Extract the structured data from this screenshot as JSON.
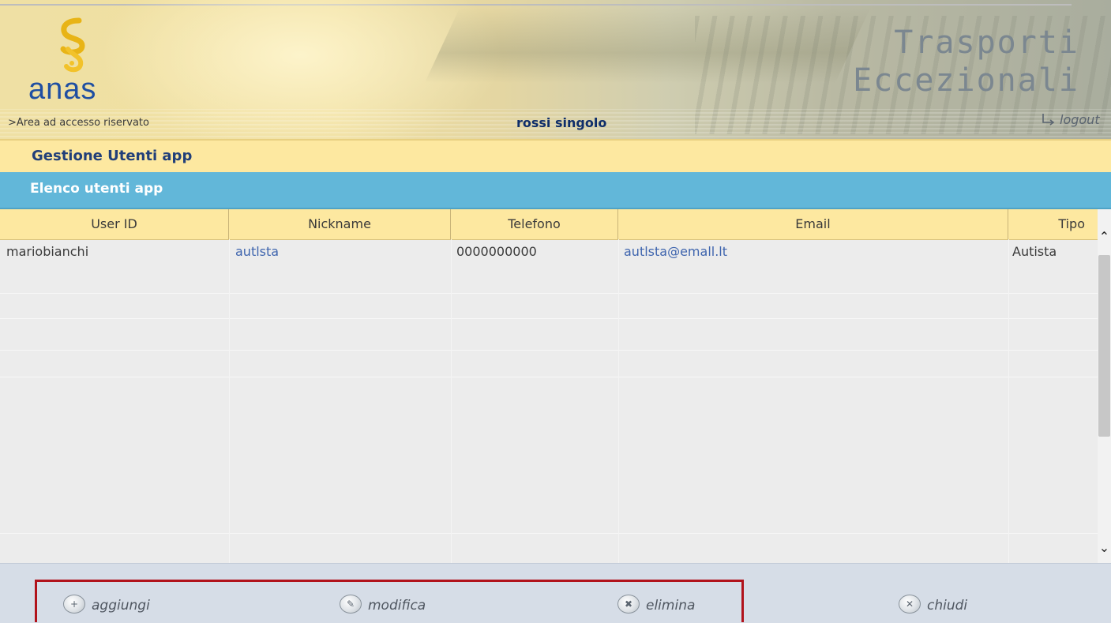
{
  "header": {
    "logo_text": "anas",
    "title_line1": "Trasporti",
    "title_line2": "Eccezionali",
    "area_label": ">Area ad accesso riservato",
    "user_name": "rossi singolo",
    "logout_label": "logout"
  },
  "section": {
    "title": "Gestione Utenti app"
  },
  "list": {
    "title": "Elenco utenti app"
  },
  "table": {
    "columns": [
      "User ID",
      "Nickname",
      "Telefono",
      "Email",
      "Tipo"
    ],
    "rows": [
      {
        "user_id": "mariobianchi",
        "nickname": "autlsta",
        "telefono": "0000000000",
        "email": "autlsta@emall.lt",
        "tipo": "Autista"
      }
    ]
  },
  "toolbar": {
    "add_label": "aggiungi",
    "edit_label": "modifica",
    "delete_label": "elimina",
    "close_label": "chiudi"
  },
  "colors": {
    "section_bg": "#fde8a0",
    "list_bar_bg": "#62b7d9",
    "link": "#3f65ae",
    "highlight": "#b1121b"
  },
  "icons": [
    "anas-logo-icon",
    "logout-arrow-icon",
    "scroll-up-icon",
    "scroll-down-icon",
    "add-icon",
    "edit-icon",
    "delete-icon",
    "close-icon"
  ]
}
